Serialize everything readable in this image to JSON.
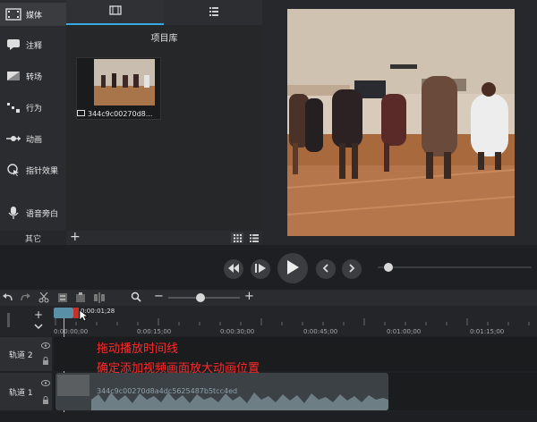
{
  "sidebar": {
    "items": [
      {
        "label": "媒体",
        "icon": "film-icon"
      },
      {
        "label": "注释",
        "icon": "annotation-icon"
      },
      {
        "label": "转场",
        "icon": "transition-icon"
      },
      {
        "label": "行为",
        "icon": "behavior-icon"
      },
      {
        "label": "动画",
        "icon": "animation-icon"
      },
      {
        "label": "指针效果",
        "icon": "cursor-effect-icon"
      },
      {
        "label": "语音旁白",
        "icon": "microphone-icon"
      }
    ],
    "other_label": "其它"
  },
  "library": {
    "title": "项目库",
    "media_name": "344c9c00270d8...",
    "add_label": "+"
  },
  "timeline": {
    "playhead_time": "0:00:01;28",
    "ticks": [
      "0:00:00;00",
      "0:00:15;00",
      "0:00:30;00",
      "0:00:45;00",
      "0:01:00;00",
      "0:01:15;00"
    ],
    "zoom_minus": "−",
    "zoom_plus": "+",
    "zoom_level": 0.4,
    "tracks": [
      {
        "label": "轨道 2"
      },
      {
        "label": "轨道 1"
      }
    ],
    "clip_name": "344c9c00270d8a4dc5625487b5tcc4ed"
  },
  "annotation": {
    "line1": "拖动播放时间线",
    "line2": "确定添加视频画面放大动画位置"
  },
  "colors": {
    "accent": "#3aa8e0",
    "annotation": "#ff2a2a",
    "background": "#1f2124"
  }
}
